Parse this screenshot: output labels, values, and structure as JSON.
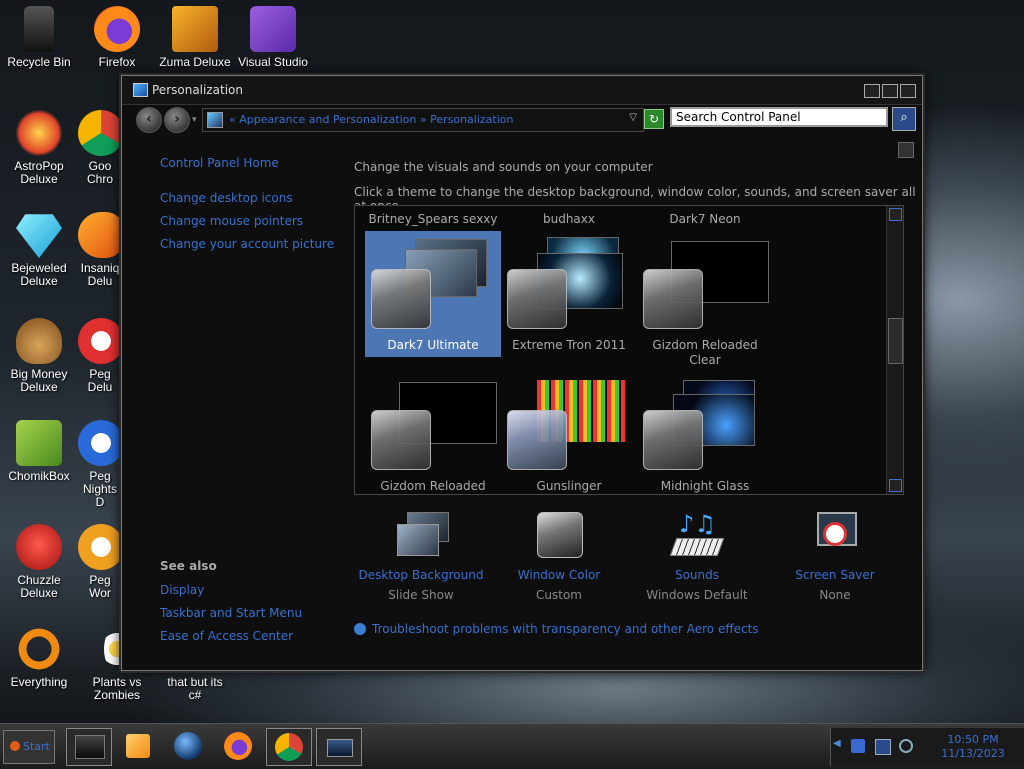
{
  "desktop": {
    "icons": [
      {
        "label": "Recycle Bin",
        "icon": "recycle-bin-icon"
      },
      {
        "label": "Firefox",
        "icon": "firefox-icon"
      },
      {
        "label": "Zuma Deluxe",
        "icon": "zuma-icon"
      },
      {
        "label": "Visual Studio",
        "icon": "visual-studio-icon"
      },
      {
        "label": "AstroPop\nDeluxe",
        "icon": "astropop-icon"
      },
      {
        "label": "Goo\nChro",
        "icon": "chrome-icon"
      },
      {
        "label": "Bejeweled\nDeluxe",
        "icon": "bejeweled-icon"
      },
      {
        "label": "Insaniq\nDelu",
        "icon": "insaniquarium-icon"
      },
      {
        "label": "Big Money\nDeluxe",
        "icon": "big-money-icon"
      },
      {
        "label": "Peg\nDelu",
        "icon": "peggle-icon"
      },
      {
        "label": "ChomikBox",
        "icon": "chomikbox-icon"
      },
      {
        "label": "Peg\nNights D",
        "icon": "peggle-nights-icon"
      },
      {
        "label": "Chuzzle\nDeluxe",
        "icon": "chuzzle-icon"
      },
      {
        "label": "Peg\nWor",
        "icon": "peggle-world-icon"
      },
      {
        "label": "Everything",
        "icon": "everything-search-icon"
      },
      {
        "label": "Plants vs\nZombies",
        "icon": "plants-vs-zombies-icon"
      },
      {
        "label": "that but its\nc#",
        "icon": "file-icon"
      }
    ]
  },
  "window": {
    "title": "Personalization",
    "address": {
      "crumbs": "« Appearance and Personalization » Personalization",
      "refresh_label": "↻"
    },
    "search": {
      "placeholder": "Search Control Panel"
    },
    "left_pane": {
      "home": "Control Panel Home",
      "links": [
        "Change desktop icons",
        "Change mouse pointers",
        "Change your account picture"
      ],
      "see_also_title": "See also",
      "see_also": [
        "Display",
        "Taskbar and Start Menu",
        "Ease of Access Center"
      ]
    },
    "main": {
      "heading": "Change the visuals and sounds on your computer",
      "subheading": "Click a theme to change the desktop background, window color, sounds, and screen saver all at once.",
      "partial_names": [
        "Britney_Spears sexxy",
        "budhaxx",
        "Dark7 Neon"
      ],
      "themes": [
        {
          "name": "Dark7 Ultimate",
          "selected": true
        },
        {
          "name": "Extreme Tron 2011",
          "selected": false
        },
        {
          "name": "Gizdom Reloaded\nClear",
          "selected": false
        },
        {
          "name": "Gizdom Reloaded",
          "selected": false
        },
        {
          "name": "Gunslinger",
          "selected": false
        },
        {
          "name": "Midnight Glass",
          "selected": false
        }
      ],
      "settings": [
        {
          "label": "Desktop Background",
          "value": "Slide Show",
          "icon": "desktop-background-icon"
        },
        {
          "label": "Window Color",
          "value": "Custom",
          "icon": "window-color-icon"
        },
        {
          "label": "Sounds",
          "value": "Windows Default",
          "icon": "sounds-icon"
        },
        {
          "label": "Screen Saver",
          "value": "None",
          "icon": "screen-saver-icon"
        }
      ],
      "troubleshoot": "Troubleshoot problems with transparency and other Aero effects"
    }
  },
  "taskbar": {
    "start_label": "Start",
    "items": [
      "terminal-icon",
      "media-player-icon",
      "network-globe-icon",
      "firefox-icon",
      "chrome-icon",
      "control-panel-icon"
    ],
    "clock": {
      "time": "10:50 PM",
      "date": "11/13/2023"
    }
  },
  "colors": {
    "link": "#3a6fd0",
    "selection": "#4d76b4"
  }
}
